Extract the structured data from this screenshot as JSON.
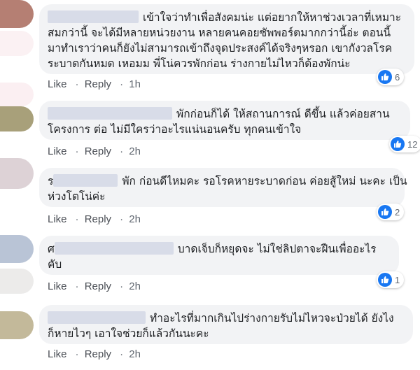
{
  "comments": [
    {
      "prefix": "",
      "lines": [
        "เข้าใจว่าทำเพื่อสังคมน่ะ แต่อยากให้หาช่วงเวลาที่เหมาะ",
        "สมกว่านี้ จะได้มีหลายหน่วยงาน หลายคนคอยซัพพอร์ตมากกว่านี้อ่ะ ตอนนี้",
        "มาทำเราว่าคนก็ยังไม่สามารถเข้าถึงจุดประสงค์ได้จริงๆหรอก เขากังวลโรค",
        "ระบาดกันหมด เหอมม พี่โน่ควรพักก่อน ร่างกายไม่ไหวก็ต้องพักน่ะ"
      ],
      "like": "Like",
      "reply": "Reply",
      "time": "1h",
      "reactions": "6",
      "avatar_color": "#b57f73"
    },
    {
      "prefix": "",
      "lines": [
        "พักก่อนก็ได้ ให้สถานการณ์ ดีขึ้น แล้วค่อยสาน",
        "โครงการ ต่อ ไม่มีใครว่าอะไรแน่นอนครับ ทุกคนเข้าใจ"
      ],
      "like": "Like",
      "reply": "Reply",
      "time": "2h",
      "reactions": "12",
      "avatar_color": "#a8a07a"
    },
    {
      "prefix": "ร",
      "lines": [
        "พัก ก่อนดีไหมคะ รอโรคหายระบาดก่อน ค่อยสู้ใหม่ นะคะ เป็น",
        "ห่วงโตโน่ค่ะ"
      ],
      "like": "Like",
      "reply": "Reply",
      "time": "2h",
      "reactions": "2",
      "avatar_color": "#ddd2d6"
    },
    {
      "prefix": "ศ",
      "lines": [
        "บาดเจ็บก็หยุดจะ ไม่ใช่ลิปตาจะฝืนเพื่ออะไร",
        "คับ"
      ],
      "like": "Like",
      "reply": "Reply",
      "time": "2h",
      "reactions": "1",
      "avatar_color": "#b9c4d6"
    },
    {
      "prefix": "",
      "lines": [
        "ทำอะไรที่มากเกินไปร่างกายรับไม่ไหวจะป่วยได้ ยังไง",
        "ก็หายไวๆ เอาใจช่วยก็แล้วกันนะคะ"
      ],
      "like": "Like",
      "reply": "Reply",
      "time": "2h",
      "reactions": "",
      "avatar_color": "#c3b99a"
    }
  ],
  "colors": {
    "like_blue": "#1877f2",
    "bubble_bg": "#f2f3f5",
    "meta_text": "#606770"
  },
  "icons": {
    "reaction": "thumbs-up-icon"
  }
}
